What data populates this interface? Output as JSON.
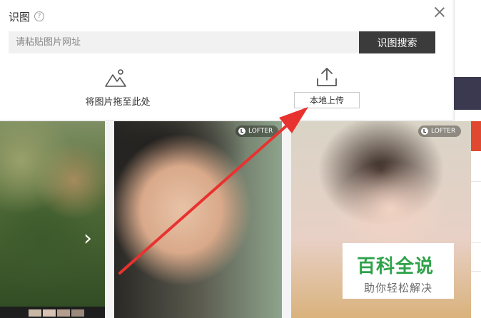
{
  "dialog": {
    "title": "识图",
    "help_symbol": "?",
    "search": {
      "placeholder": "请粘贴图片网址",
      "button_label": "识图搜索"
    },
    "drag_area": {
      "label": "将图片拖至此处",
      "icon": "image-mountain-icon"
    },
    "upload": {
      "label": "本地上传",
      "icon": "upload-tray-icon"
    },
    "close_icon": "close-icon"
  },
  "gallery": {
    "cards": [
      {
        "name": "forest-photo",
        "next_symbol": "›"
      },
      {
        "name": "portrait-photo-1",
        "badge": "LOFTER"
      },
      {
        "name": "portrait-photo-2",
        "badge": "LOFTER"
      }
    ]
  },
  "watermark": {
    "title": "百科全说",
    "subtitle": "助你轻松解决"
  },
  "colors": {
    "accent_dark": "#3b3b3b",
    "annotation_arrow": "#e8322f",
    "watermark_green": "#2fa24a",
    "side_tab_red": "#e0492f"
  }
}
